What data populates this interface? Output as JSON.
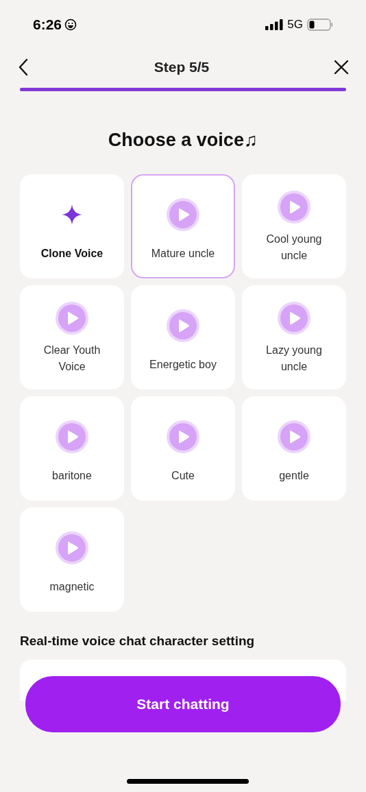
{
  "status_bar": {
    "time": "6:26",
    "network": "5G"
  },
  "nav": {
    "title": "Step 5/5",
    "progress": {
      "level": 1
    }
  },
  "heading": "Choose a voice♫",
  "voices": [
    {
      "kind": "clone",
      "label": "Clone Voice",
      "selected": false
    },
    {
      "kind": "voice",
      "label": "Mature uncle",
      "selected": true
    },
    {
      "kind": "voice",
      "label": "Cool young uncle",
      "selected": false
    },
    {
      "kind": "voice",
      "label": "Clear Youth Voice",
      "selected": false
    },
    {
      "kind": "voice",
      "label": "Energetic boy",
      "selected": false
    },
    {
      "kind": "voice",
      "label": "Lazy young uncle",
      "selected": false
    },
    {
      "kind": "voice",
      "label": "baritone",
      "selected": false
    },
    {
      "kind": "voice",
      "label": "Cute",
      "selected": false
    },
    {
      "kind": "voice",
      "label": "gentle",
      "selected": false
    },
    {
      "kind": "voice",
      "label": "magnetic",
      "selected": false
    }
  ],
  "section_title": "Real-time voice chat character setting",
  "start_button": "Start chatting"
}
